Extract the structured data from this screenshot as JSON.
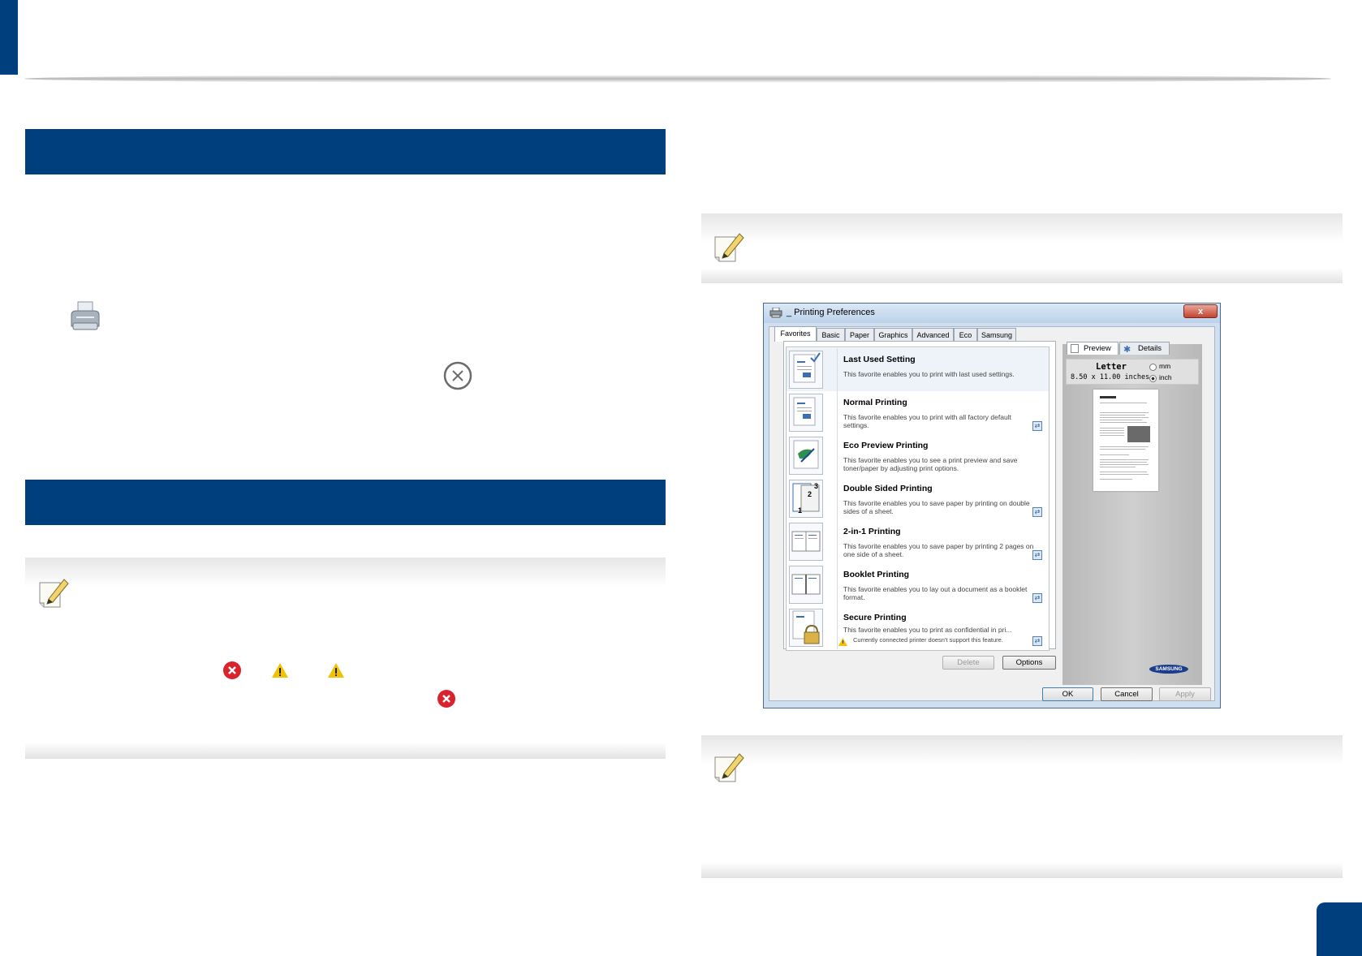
{
  "dialog": {
    "title": "_ Printing Preferences",
    "close_label": "x",
    "tabs": [
      "Favorites",
      "Basic",
      "Paper",
      "Graphics",
      "Advanced",
      "Eco",
      "Samsung"
    ],
    "favorites": [
      {
        "title": "Last Used Setting",
        "desc": "This favorite enables you to print with last used settings."
      },
      {
        "title": "Normal Printing",
        "desc": "This favorite enables you to print with all factory default settings."
      },
      {
        "title": "Eco Preview Printing",
        "desc": "This favorite enables you to see a print preview and save toner/paper by adjusting print options."
      },
      {
        "title": "Double Sided Printing",
        "desc": "This favorite enables you to save paper by printing on double sides of a sheet."
      },
      {
        "title": "2-in-1 Printing",
        "desc": "This favorite enables you to save paper by printing 2 pages on one side of a sheet."
      },
      {
        "title": "Booklet Printing",
        "desc": "This favorite enables you to lay out a document as a booklet format."
      },
      {
        "title": "Secure Printing",
        "desc": "This favorite enables you to print as confidential in pri...",
        "warning": "Currently connected printer doesn't support this feature."
      }
    ],
    "double_sided_numbers": [
      "3",
      "2",
      "1"
    ],
    "buttons": {
      "delete": "Delete",
      "options": "Options",
      "ok": "OK",
      "cancel": "Cancel",
      "apply": "Apply"
    },
    "preview_tabs": [
      "Preview",
      "Details"
    ],
    "paper_name": "Letter",
    "paper_size": "8.50 x 11.00 inches",
    "units": [
      "mm",
      "inch"
    ],
    "brand": "SAMSUNG"
  },
  "colors": {
    "brand_blue": "#003f7d",
    "error_red": "#d9232d",
    "warning_yellow": "#f2c200"
  }
}
